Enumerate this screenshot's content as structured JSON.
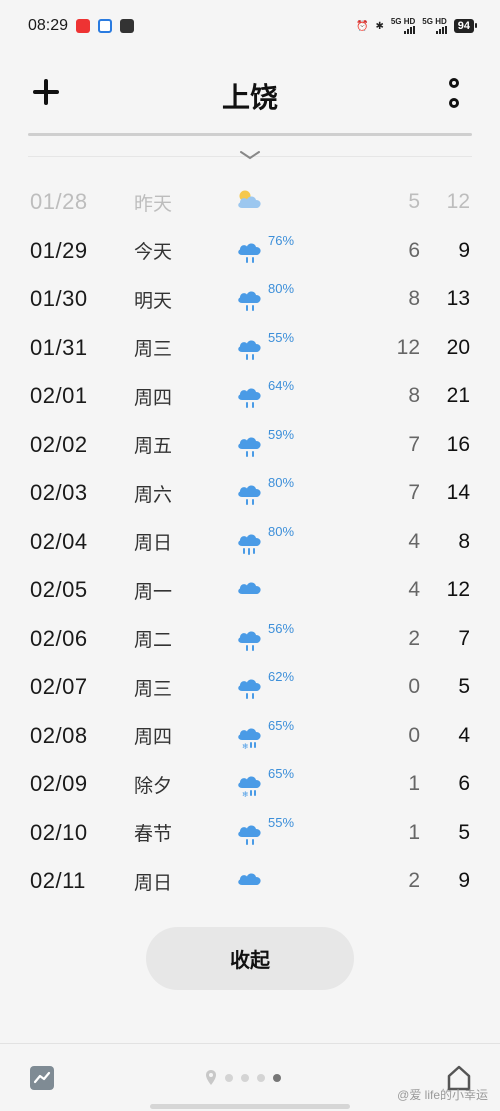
{
  "status_bar": {
    "time": "08:29",
    "signal1": "5G HD",
    "signal2": "5G HD",
    "battery": "94"
  },
  "header": {
    "city": "上饶"
  },
  "forecast": [
    {
      "date": "01/28",
      "day": "昨天",
      "icon": "partly-cloudy-icon",
      "pop": "",
      "low": "5",
      "high": "12",
      "past": true
    },
    {
      "date": "01/29",
      "day": "今天",
      "icon": "rain-icon",
      "pop": "76%",
      "low": "6",
      "high": "9"
    },
    {
      "date": "01/30",
      "day": "明天",
      "icon": "rain-icon",
      "pop": "80%",
      "low": "8",
      "high": "13"
    },
    {
      "date": "01/31",
      "day": "周三",
      "icon": "rain-icon",
      "pop": "55%",
      "low": "12",
      "high": "20"
    },
    {
      "date": "02/01",
      "day": "周四",
      "icon": "rain-icon",
      "pop": "64%",
      "low": "8",
      "high": "21"
    },
    {
      "date": "02/02",
      "day": "周五",
      "icon": "rain-icon",
      "pop": "59%",
      "low": "7",
      "high": "16"
    },
    {
      "date": "02/03",
      "day": "周六",
      "icon": "rain-icon",
      "pop": "80%",
      "low": "7",
      "high": "14"
    },
    {
      "date": "02/04",
      "day": "周日",
      "icon": "heavy-rain-icon",
      "pop": "80%",
      "low": "4",
      "high": "8"
    },
    {
      "date": "02/05",
      "day": "周一",
      "icon": "cloudy-icon",
      "pop": "",
      "low": "4",
      "high": "12"
    },
    {
      "date": "02/06",
      "day": "周二",
      "icon": "rain-icon",
      "pop": "56%",
      "low": "2",
      "high": "7"
    },
    {
      "date": "02/07",
      "day": "周三",
      "icon": "rain-icon",
      "pop": "62%",
      "low": "0",
      "high": "5"
    },
    {
      "date": "02/08",
      "day": "周四",
      "icon": "sleet-icon",
      "pop": "65%",
      "low": "0",
      "high": "4"
    },
    {
      "date": "02/09",
      "day": "除夕",
      "icon": "sleet-icon",
      "pop": "65%",
      "low": "1",
      "high": "6"
    },
    {
      "date": "02/10",
      "day": "春节",
      "icon": "rain-icon",
      "pop": "55%",
      "low": "1",
      "high": "5"
    },
    {
      "date": "02/11",
      "day": "周日",
      "icon": "cloudy-icon",
      "pop": "",
      "low": "2",
      "high": "9"
    }
  ],
  "collapse_button": "收起",
  "footer": {
    "watermark": "@爱 life的小幸运",
    "page_count": 4,
    "active_page": 4
  },
  "colors": {
    "accent": "#3d8fd9",
    "cloud": "#4a9be6",
    "background": "#f5f5f5"
  }
}
